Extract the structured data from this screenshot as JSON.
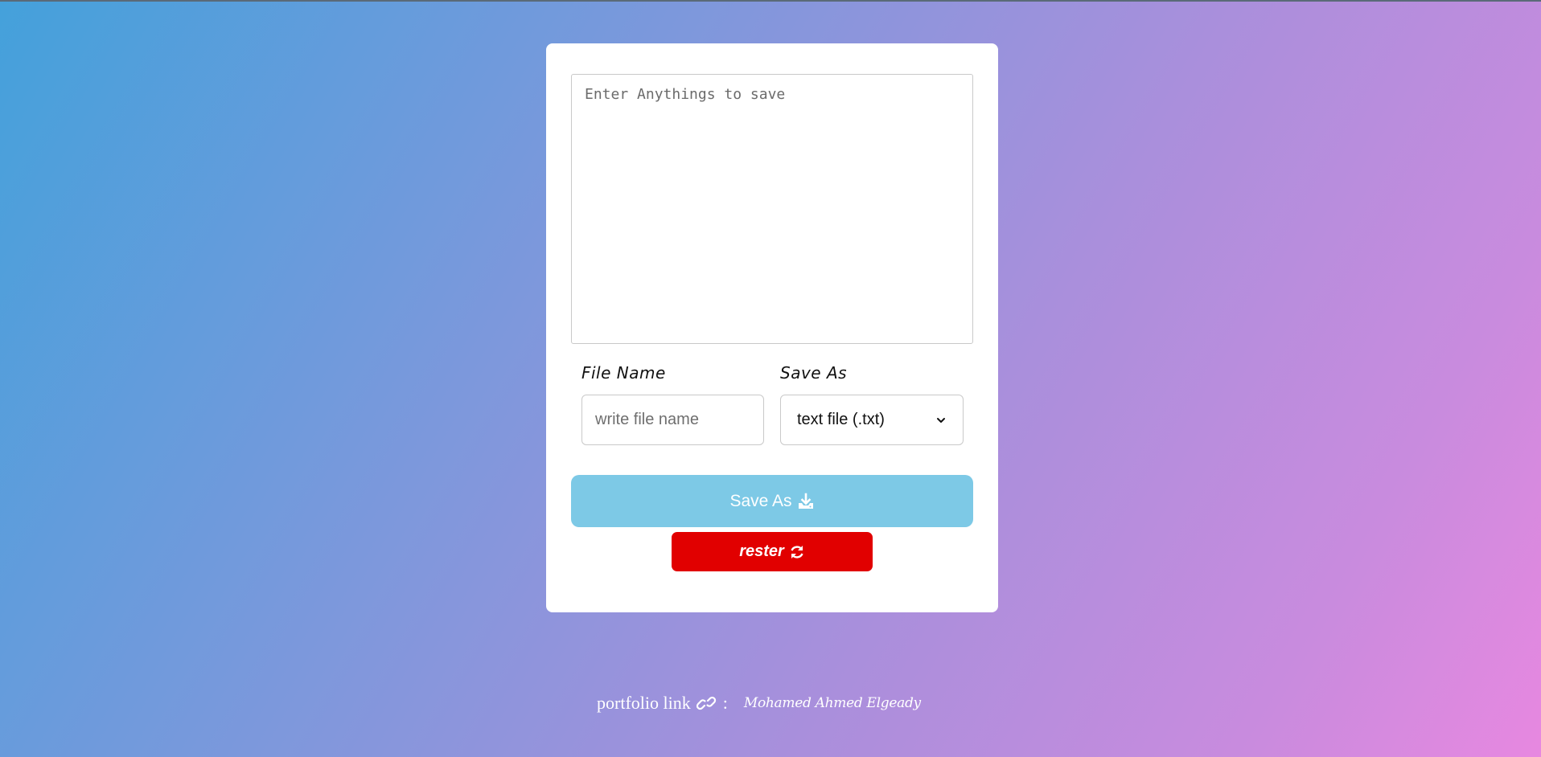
{
  "editor": {
    "placeholder": "Enter Anythings to save"
  },
  "form": {
    "file_name_label": "File Name",
    "file_name_placeholder": "write file name",
    "save_as_label": "Save As",
    "save_as_selected": "text file (.txt)"
  },
  "actions": {
    "save_label": "Save As",
    "save_icon": "download-icon",
    "reset_label": "rester",
    "reset_icon": "refresh-icon"
  },
  "footer": {
    "portfolio_text": "portfolio link",
    "link_icon": "link-icon",
    "separator": ":",
    "author": "Mohamed Ahmed Elgeady"
  },
  "colors": {
    "save_button": "#7dc9e6",
    "reset_button": "#e10000",
    "gradient_start": "#44a1db",
    "gradient_end": "#e788e0"
  }
}
